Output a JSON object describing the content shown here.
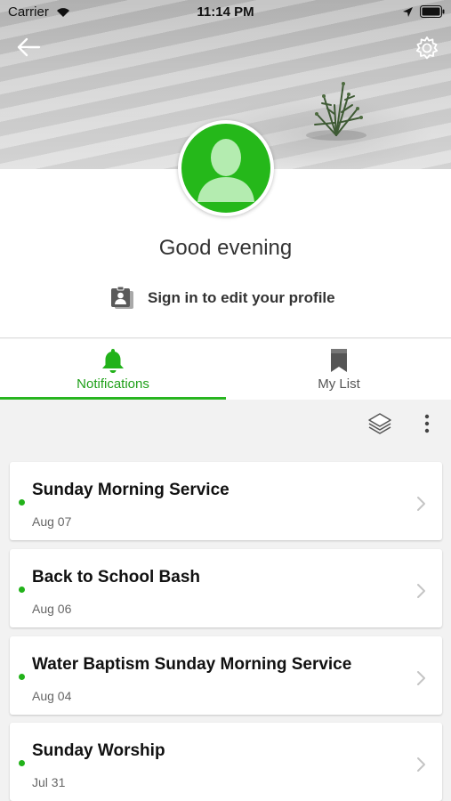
{
  "status_bar": {
    "carrier": "Carrier",
    "time": "11:14 PM"
  },
  "profile": {
    "greeting": "Good evening",
    "signin_label": "Sign in to edit your profile",
    "accent_color": "#25b81a"
  },
  "tabs": [
    {
      "label": "Notifications",
      "icon": "bell-icon",
      "active": true
    },
    {
      "label": "My List",
      "icon": "bookmark-icon",
      "active": false
    }
  ],
  "notifications": [
    {
      "title": "Sunday Morning Service",
      "date": "Aug 07",
      "unread": true
    },
    {
      "title": "Back to School Bash",
      "date": "Aug 06",
      "unread": true
    },
    {
      "title": "Water Baptism Sunday Morning Service",
      "date": "Aug 04",
      "unread": true
    },
    {
      "title": "Sunday Worship",
      "date": "Jul 31",
      "unread": true
    }
  ]
}
